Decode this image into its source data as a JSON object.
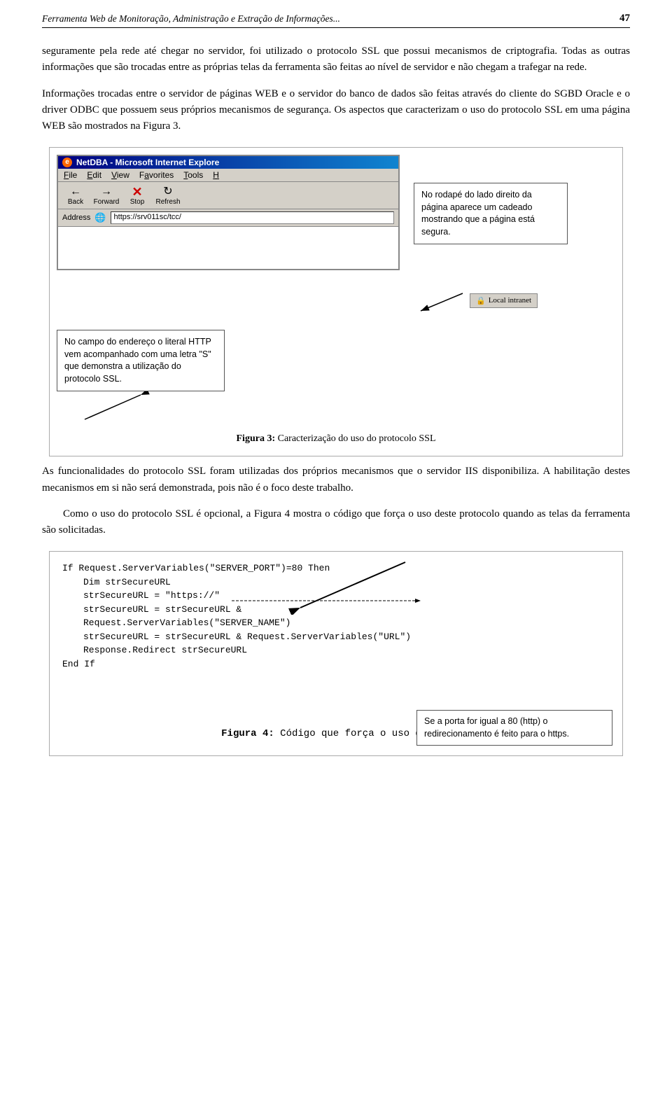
{
  "header": {
    "title": "Ferramenta Web de Monitoração, Administração e Extração de Informações...",
    "page_number": "47"
  },
  "paragraphs": {
    "p1": "seguramente pela rede até chegar no servidor, foi utilizado o protocolo SSL que possui mecanismos de criptografia.",
    "p2": "Todas as outras informações que são trocadas entre as próprias telas da ferramenta são feitas ao nível de servidor e não chegam a trafegar na rede.",
    "p3": "Informações trocadas entre o servidor de páginas WEB e o servidor do banco de dados são feitas através do cliente do SGBD Oracle e o driver ODBC que possuem seus próprios mecanismos de segurança.",
    "p4": "Os aspectos que caracterizam o uso do protocolo SSL em uma página WEB são mostrados na Figura 3.",
    "p5": "As funcionalidades do protocolo SSL foram utilizadas dos próprios mecanismos que o servidor IIS disponibiliza. A habilitação destes mecanismos em si não será demonstrada, pois não é o foco deste trabalho.",
    "p6": "Como o uso do protocolo SSL é opcional, a Figura 4 mostra o código que força o uso deste protocolo quando as telas da ferramenta são solicitadas."
  },
  "figure3": {
    "browser_title": "NetDBA - Microsoft Internet Explore",
    "menu_items": [
      "File",
      "Edit",
      "View",
      "Favorites",
      "Tools",
      "H"
    ],
    "back_label": "Back",
    "forward_label": "Forward",
    "stop_label": "Stop",
    "refresh_label": "Refresh",
    "address_label": "Address",
    "address_value": "https://srv011sc/tcc/",
    "callout_right": "No rodapé do lado direito da página aparece um cadeado mostrando que a página está segura.",
    "callout_bottom": "No campo do endereço o literal HTTP vem acompanhado com uma letra \"S\" que demonstra a utilização do protocolo SSL.",
    "statusbar_text": "Local intranet",
    "caption_bold": "Figura 3:",
    "caption_text": " Caracterização do uso do protocolo SSL"
  },
  "figure4": {
    "code_lines": [
      "If Request.ServerVariables(\"SERVER_PORT\")=80 Then",
      "    Dim strSecureURL",
      "    strSecureURL = \"https://\"",
      "    strSecureURL = strSecureURL &",
      "  Request.ServerVariables(\"SERVER_NAME\")",
      "    strSecureURL = strSecureURL & Request.ServerVariables(\"URL\")",
      "    Response.Redirect strSecureURL",
      "End If"
    ],
    "callout_text": "Se a porta for igual a 80 (http) o redirecionamento é feito para o https.",
    "caption_bold": "Figura 4:",
    "caption_text": " Código que força o uso do SSL"
  }
}
